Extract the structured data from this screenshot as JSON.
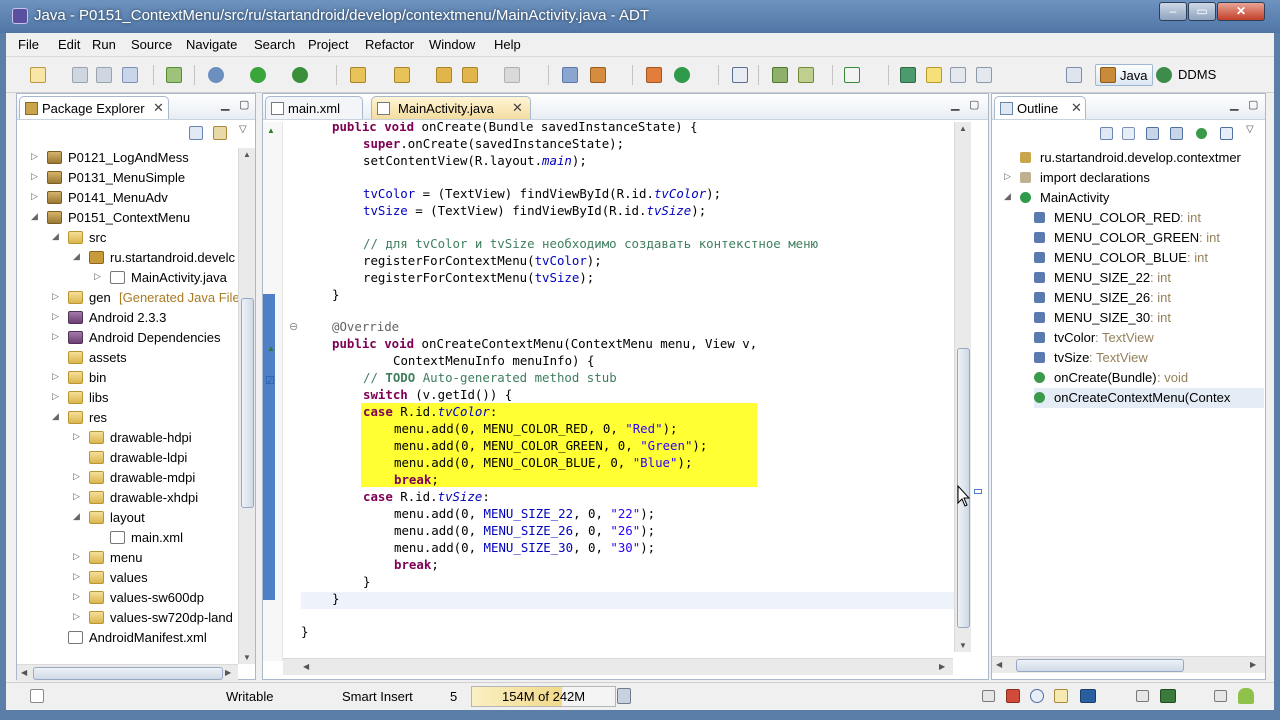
{
  "window": {
    "title": "Java - P0151_ContextMenu/src/ru/startandroid/develop/contextmenu/MainActivity.java - ADT",
    "min_glyph": "–",
    "max_glyph": "▭",
    "close_glyph": "✕"
  },
  "menu": [
    "File",
    "Edit",
    "Run",
    "Source",
    "Navigate",
    "Search",
    "Project",
    "Refactor",
    "Window",
    "Help"
  ],
  "perspectives": {
    "java": "Java",
    "ddms": "DDMS"
  },
  "package_explorer": {
    "title": "Package Explorer",
    "items": [
      {
        "label": "P0121_LogAndMess",
        "arrow": "▷",
        "icon": "project"
      },
      {
        "label": "P0131_MenuSimple",
        "arrow": "▷",
        "icon": "project"
      },
      {
        "label": "P0141_MenuAdv",
        "arrow": "▷",
        "icon": "project"
      },
      {
        "label": "P0151_ContextMenu",
        "arrow": "◢",
        "icon": "project"
      },
      {
        "label": "src",
        "arrow": "◢",
        "icon": "folder"
      },
      {
        "label": "ru.startandroid.develc",
        "arrow": "◢",
        "icon": "pkg"
      },
      {
        "label": "MainActivity.java",
        "arrow": "▷",
        "icon": "javafile"
      },
      {
        "label": "gen",
        "decor": "[Generated Java Files",
        "arrow": "▷",
        "icon": "folder"
      },
      {
        "label": "Android 2.3.3",
        "arrow": "▷",
        "icon": "lib"
      },
      {
        "label": "Android Dependencies",
        "arrow": "▷",
        "icon": "lib"
      },
      {
        "label": "assets",
        "arrow": "",
        "icon": "folder"
      },
      {
        "label": "bin",
        "arrow": "▷",
        "icon": "folder"
      },
      {
        "label": "libs",
        "arrow": "▷",
        "icon": "folder"
      },
      {
        "label": "res",
        "arrow": "◢",
        "icon": "folder"
      },
      {
        "label": "drawable-hdpi",
        "arrow": "▷",
        "icon": "folder"
      },
      {
        "label": "drawable-ldpi",
        "arrow": "",
        "icon": "folder"
      },
      {
        "label": "drawable-mdpi",
        "arrow": "▷",
        "icon": "folder"
      },
      {
        "label": "drawable-xhdpi",
        "arrow": "▷",
        "icon": "folder"
      },
      {
        "label": "layout",
        "arrow": "◢",
        "icon": "folder"
      },
      {
        "label": "main.xml",
        "arrow": "",
        "icon": "javafile"
      },
      {
        "label": "menu",
        "arrow": "▷",
        "icon": "folder"
      },
      {
        "label": "values",
        "arrow": "▷",
        "icon": "folder"
      },
      {
        "label": "values-sw600dp",
        "arrow": "▷",
        "icon": "folder"
      },
      {
        "label": "values-sw720dp-land",
        "arrow": "▷",
        "icon": "folder"
      },
      {
        "label": "AndroidManifest.xml",
        "arrow": "",
        "icon": "javafile"
      }
    ]
  },
  "editor": {
    "tabs": [
      {
        "label": "main.xml"
      },
      {
        "label": "MainActivity.java",
        "active": true
      }
    ],
    "close_glyph": "✕"
  },
  "outline": {
    "title": "Outline",
    "items": [
      {
        "label": "ru.startandroid.develop.contextmer",
        "suffix": ""
      },
      {
        "label": "import declarations",
        "suffix": ""
      },
      {
        "label": "MainActivity",
        "suffix": ""
      },
      {
        "label": "MENU_COLOR_RED",
        "suffix": " : int"
      },
      {
        "label": "MENU_COLOR_GREEN",
        "suffix": " : int"
      },
      {
        "label": "MENU_COLOR_BLUE",
        "suffix": " : int"
      },
      {
        "label": "MENU_SIZE_22",
        "suffix": " : int"
      },
      {
        "label": "MENU_SIZE_26",
        "suffix": " : int"
      },
      {
        "label": "MENU_SIZE_30",
        "suffix": " : int"
      },
      {
        "label": "tvColor",
        "suffix": " : TextView"
      },
      {
        "label": "tvSize",
        "suffix": " : TextView"
      },
      {
        "label": "onCreate(Bundle)",
        "suffix": " : void"
      },
      {
        "label": "onCreateContextMenu(Contex",
        "suffix": ""
      }
    ]
  },
  "status": {
    "writable": "Writable",
    "insert_mode": "Smart Insert",
    "position": "5",
    "heap": "154M of 242M"
  },
  "colors": {
    "accent": "#6f93bf",
    "highlight": "#ffff33",
    "keyword": "#7f0055",
    "comment": "#3f7f5f",
    "string": "#2a00ff"
  }
}
